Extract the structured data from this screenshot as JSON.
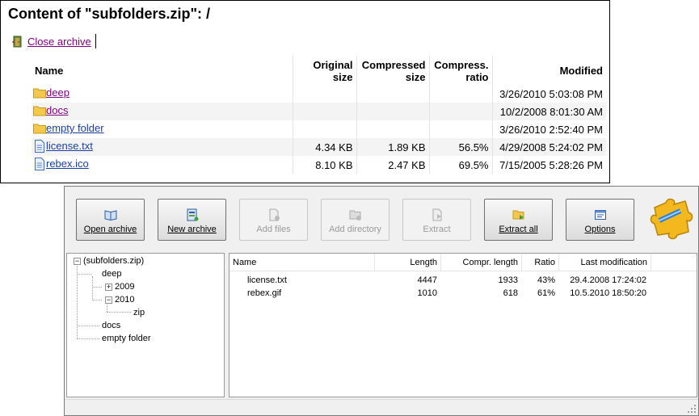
{
  "web": {
    "title": "Content of \"subfolders.zip\": /",
    "close_link": "Close archive",
    "columns": {
      "name": "Name",
      "original_size": [
        "Original",
        "size"
      ],
      "compressed_size": [
        "Compressed",
        "size"
      ],
      "compress_ratio": [
        "Compress.",
        "ratio"
      ],
      "modified": "Modified"
    },
    "rows": [
      {
        "name": "deep",
        "type": "folder",
        "original": "",
        "compressed": "",
        "ratio": "",
        "modified": "3/26/2010 5:03:08 PM"
      },
      {
        "name": "docs",
        "type": "folder",
        "original": "",
        "compressed": "",
        "ratio": "",
        "modified": "10/2/2008 8:01:30 AM"
      },
      {
        "name": "empty folder",
        "type": "folder",
        "original": "",
        "compressed": "",
        "ratio": "",
        "modified": "3/26/2010 2:52:40 PM"
      },
      {
        "name": "license.txt",
        "type": "file",
        "original": "4.34 KB",
        "compressed": "1.89 KB",
        "ratio": "56.5%",
        "modified": "4/29/2008 5:24:02 PM"
      },
      {
        "name": "rebex.ico",
        "type": "file",
        "original": "8.10 KB",
        "compressed": "2.47 KB",
        "ratio": "69.5%",
        "modified": "7/15/2005 5:28:26 PM"
      }
    ]
  },
  "app": {
    "toolbar": {
      "open_archive": "Open archive",
      "new_archive": "New archive",
      "add_files": "Add files",
      "add_directory": "Add directory",
      "extract": "Extract",
      "extract_all": "Extract all",
      "options": "Options"
    },
    "tree": {
      "root": "(subfolders.zip)",
      "deep": "deep",
      "y2009": "2009",
      "y2010": "2010",
      "zip": "zip",
      "docs": "docs",
      "empty_folder": "empty folder"
    },
    "list": {
      "columns": {
        "name": "Name",
        "length": "Length",
        "compr_length": "Compr. length",
        "ratio": "Ratio",
        "last_modification": "Last modification"
      },
      "rows": [
        {
          "name": "license.txt",
          "length": "4447",
          "compr_length": "1933",
          "ratio": "43%",
          "last_modification": "29.4.2008 17:24:02"
        },
        {
          "name": "rebex.gif",
          "length": "1010",
          "compr_length": "618",
          "ratio": "61%",
          "last_modification": "10.5.2010 18:50:20"
        }
      ]
    },
    "colors": {
      "folder": "#f2c94c",
      "link_visited": "#800080",
      "link": "#1a3fa0"
    },
    "icons": [
      "door-icon",
      "folder-icon",
      "file-icon",
      "book-icon",
      "new-archive-icon",
      "add-files-icon",
      "add-directory-icon",
      "extract-icon",
      "extract-all-icon",
      "options-icon",
      "puzzle-logo-icon"
    ]
  }
}
